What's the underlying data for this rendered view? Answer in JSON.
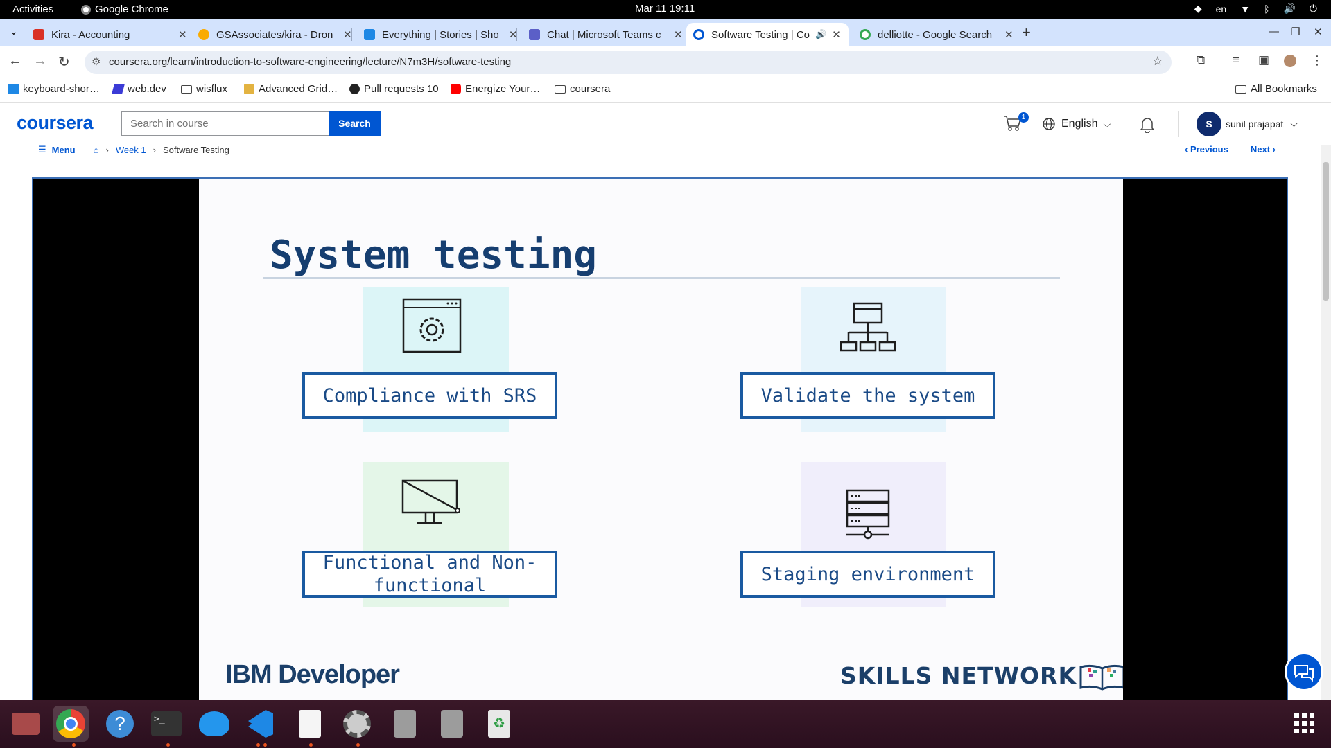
{
  "system_bar": {
    "activities": "Activities",
    "app_name": "Google Chrome",
    "clock": "Mar 11  19:11",
    "lang": "en"
  },
  "tabs": [
    {
      "title": "Kira - Accounting",
      "color": "#d93025"
    },
    {
      "title": "GSAssociates/kira - Dron",
      "color": "#f9ab00"
    },
    {
      "title": "Everything | Stories | Sho",
      "color": "#1e88e5"
    },
    {
      "title": "Chat | Microsoft Teams c",
      "color": "#5b5fc7"
    },
    {
      "title": "Software Testing | Co",
      "color": "#0056d2"
    },
    {
      "title": "delliotte - Google Search",
      "color": "#34a853"
    }
  ],
  "address_bar": {
    "url": "coursera.org/learn/introduction-to-software-engineering/lecture/N7m3H/software-testing"
  },
  "bookmarks": [
    {
      "label": "keyboard-shor…"
    },
    {
      "label": "web.dev"
    },
    {
      "label": "wisflux"
    },
    {
      "label": "Advanced Grid…"
    },
    {
      "label": "Pull requests 10"
    },
    {
      "label": "Energize Your…"
    },
    {
      "label": "coursera"
    }
  ],
  "all_bookmarks": "All Bookmarks",
  "coursera": {
    "logo": "coursera",
    "search_placeholder": "Search in course",
    "search_button": "Search",
    "cart_count": "1",
    "language": "English",
    "avatar_initial": "S",
    "user_name": "sunil prajapat"
  },
  "breadcrumb": {
    "menu": "Menu",
    "week": "Week 1",
    "current": "Software Testing",
    "previous": "Previous",
    "next": "Next"
  },
  "slide": {
    "title": "System testing",
    "boxes": [
      "Compliance with SRS",
      "Validate the system",
      "Functional and Non-functional",
      "Staging environment"
    ],
    "brand_left_bold": "IBM",
    "brand_left_thin": "Developer",
    "brand_right": "SKILLS NETWORK"
  }
}
